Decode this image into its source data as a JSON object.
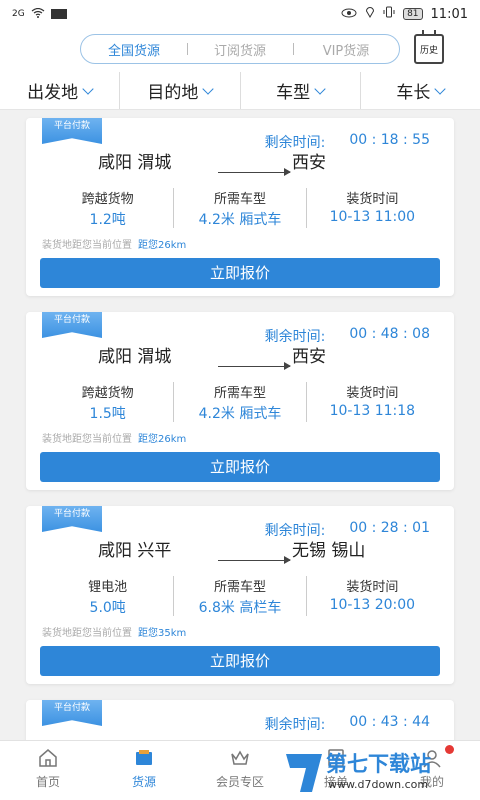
{
  "status": {
    "signal": "2G",
    "time": "11:01",
    "battery": "81"
  },
  "topbar": {
    "segments": [
      "全国货源",
      "订阅货源",
      "VIP货源"
    ],
    "history_label": "历史"
  },
  "filters": [
    "出发地",
    "目的地",
    "车型",
    "车长"
  ],
  "cards": [
    {
      "badge": "平台付款",
      "remain_label": "剩余时间:",
      "remain": "00 : 18 : 55",
      "from": "咸阳 渭城",
      "to": "西安",
      "c1l": "跨越货物",
      "c1v": "1.2吨",
      "c2l": "所需车型",
      "c2v": "4.2米 厢式车",
      "c3l": "装货时间",
      "c3v": "10-13 11:00",
      "dist_label": "装货地距您当前位置",
      "dist": "距您26km",
      "btn": "立即报价"
    },
    {
      "badge": "平台付款",
      "remain_label": "剩余时间:",
      "remain": "00 : 48 : 08",
      "from": "咸阳 渭城",
      "to": "西安",
      "c1l": "跨越货物",
      "c1v": "1.5吨",
      "c2l": "所需车型",
      "c2v": "4.2米 厢式车",
      "c3l": "装货时间",
      "c3v": "10-13 11:18",
      "dist_label": "装货地距您当前位置",
      "dist": "距您26km",
      "btn": "立即报价"
    },
    {
      "badge": "平台付款",
      "remain_label": "剩余时间:",
      "remain": "00 : 28 : 01",
      "from": "咸阳 兴平",
      "to": "无锡 锡山",
      "c1l": "锂电池",
      "c1v": "5.0吨",
      "c2l": "所需车型",
      "c2v": "6.8米 高栏车",
      "c3l": "装货时间",
      "c3v": "10-13 20:00",
      "dist_label": "装货地距您当前位置",
      "dist": "距您35km",
      "btn": "立即报价"
    },
    {
      "badge": "平台付款",
      "remain_label": "剩余时间:",
      "remain": "00 : 43 : 44"
    }
  ],
  "tabbar": [
    {
      "label": "首页",
      "icon": "home-icon"
    },
    {
      "label": "货源",
      "icon": "cargo-icon"
    },
    {
      "label": "会员专区",
      "icon": "crown-icon"
    },
    {
      "label": "接单",
      "icon": "order-icon"
    },
    {
      "label": "我的",
      "icon": "user-icon"
    }
  ],
  "watermark": {
    "title": "第七下载站",
    "url": "www.d7down.com"
  },
  "colors": {
    "accent": "#2e86d8",
    "badge_red": "#e53935"
  }
}
